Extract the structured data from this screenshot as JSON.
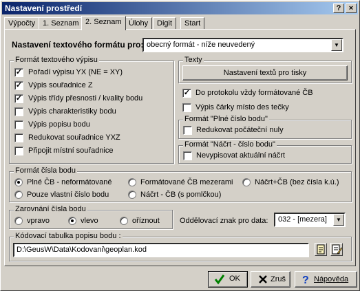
{
  "window": {
    "title": "Nastavení prostředí",
    "help_btn": "?",
    "close_btn": "×"
  },
  "tabs": [
    "Výpočty",
    "1. Seznam",
    "2. Seznam",
    "Úlohy",
    "Digit",
    "Start"
  ],
  "format": {
    "label": "Nastavení textového formátu pro:",
    "value": "obecný formát - níže neuvedený"
  },
  "vypis": {
    "title": "Formát textového výpisu",
    "items": [
      {
        "label": "Pořadí výpisu YX (NE = XY)",
        "checked": true
      },
      {
        "label": "Výpis souřadnice Z",
        "checked": true
      },
      {
        "label": "Výpis třídy přesnosti / kvality bodu",
        "checked": true
      },
      {
        "label": "Výpis charakteristiky bodu",
        "checked": false
      },
      {
        "label": "Výpis popisu bodu",
        "checked": false
      },
      {
        "label": "Redukovat souřadnice YXZ",
        "checked": false
      },
      {
        "label": "Připojit místní souřadnice",
        "checked": false
      }
    ]
  },
  "texty": {
    "title": "Texty",
    "button": "Nastavení textů pro tisky",
    "protokol": {
      "label": "Do protokolu vždy formátované ČB",
      "checked": true
    },
    "carky": {
      "label": "Výpis čárky místo des tečky",
      "checked": false
    }
  },
  "plne": {
    "title": "Formát \"Plné číslo bodu\"",
    "label": "Redukovat počáteční nuly",
    "checked": false
  },
  "nacrt": {
    "title": "Formát \"Náčrt - číslo bodu\"",
    "label": "Nevypisovat aktuální náčrt",
    "checked": false
  },
  "cislo": {
    "title": "Formát čísla bodu",
    "options": [
      {
        "label": "Plné ČB - neformátované",
        "selected": true
      },
      {
        "label": "Formátované ČB mezerami",
        "selected": false
      },
      {
        "label": "Náčrt+ČB (bez čísla k.ú.)",
        "selected": false
      },
      {
        "label": "Pouze vlastní číslo bodu",
        "selected": false
      },
      {
        "label": "Náčrt - ČB (s pomlčkou)",
        "selected": false
      }
    ]
  },
  "zarovnani": {
    "title": "Zarovnání čísla bodu",
    "options": [
      {
        "label": "vpravo",
        "selected": false
      },
      {
        "label": "vlevo",
        "selected": true
      },
      {
        "label": "oříznout",
        "selected": false
      }
    ]
  },
  "oddelovac": {
    "label": "Oddělovací znak pro data:",
    "value": "032 - [mezera]"
  },
  "kodovaci": {
    "title": "Kódovací tabulka popisu bodu :",
    "value": "D:\\GeusW\\Data\\Kodovani\\geoplan.kod"
  },
  "buttons": {
    "ok": "OK",
    "cancel": "Zruš",
    "help": "Nápověda"
  },
  "colors": {
    "title_start": "#0a246a",
    "title_end": "#a6caf0",
    "face": "#d4d0c8",
    "ok_check": "#008000",
    "cancel_x": "#000000"
  }
}
